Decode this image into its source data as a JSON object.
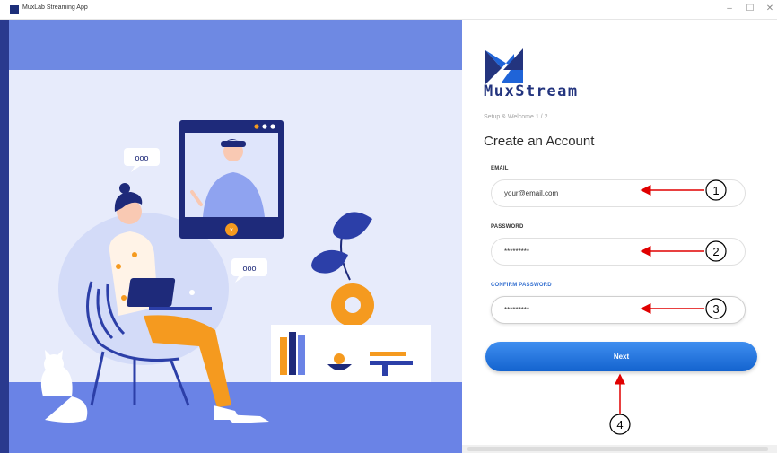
{
  "window": {
    "title": "MuxLab Streaming App",
    "controls": {
      "minimize": "–",
      "maximize": "☐",
      "close": "✕"
    }
  },
  "brand": {
    "wordmark": "MuxStream",
    "accent": "#1f64d8",
    "dark": "#23347e"
  },
  "form": {
    "step": "Setup & Welcome 1 / 2",
    "title": "Create an Account",
    "email": {
      "label": "EMAIL",
      "value": "your@email.com"
    },
    "password": {
      "label": "PASSWORD",
      "value": "*********"
    },
    "confirm": {
      "label": "CONFIRM PASSWORD",
      "value": "*********"
    },
    "next_label": "Next"
  },
  "annotations": [
    "1",
    "2",
    "3",
    "4"
  ],
  "illustration": {
    "chat_bubble_1": "ooo",
    "chat_bubble_2": "ooo",
    "colors": {
      "bg": "#e6eafb",
      "floor": "#6a83e6",
      "top": "#6e89e3",
      "orange": "#f59a1f",
      "navy": "#1e2a7a"
    }
  }
}
